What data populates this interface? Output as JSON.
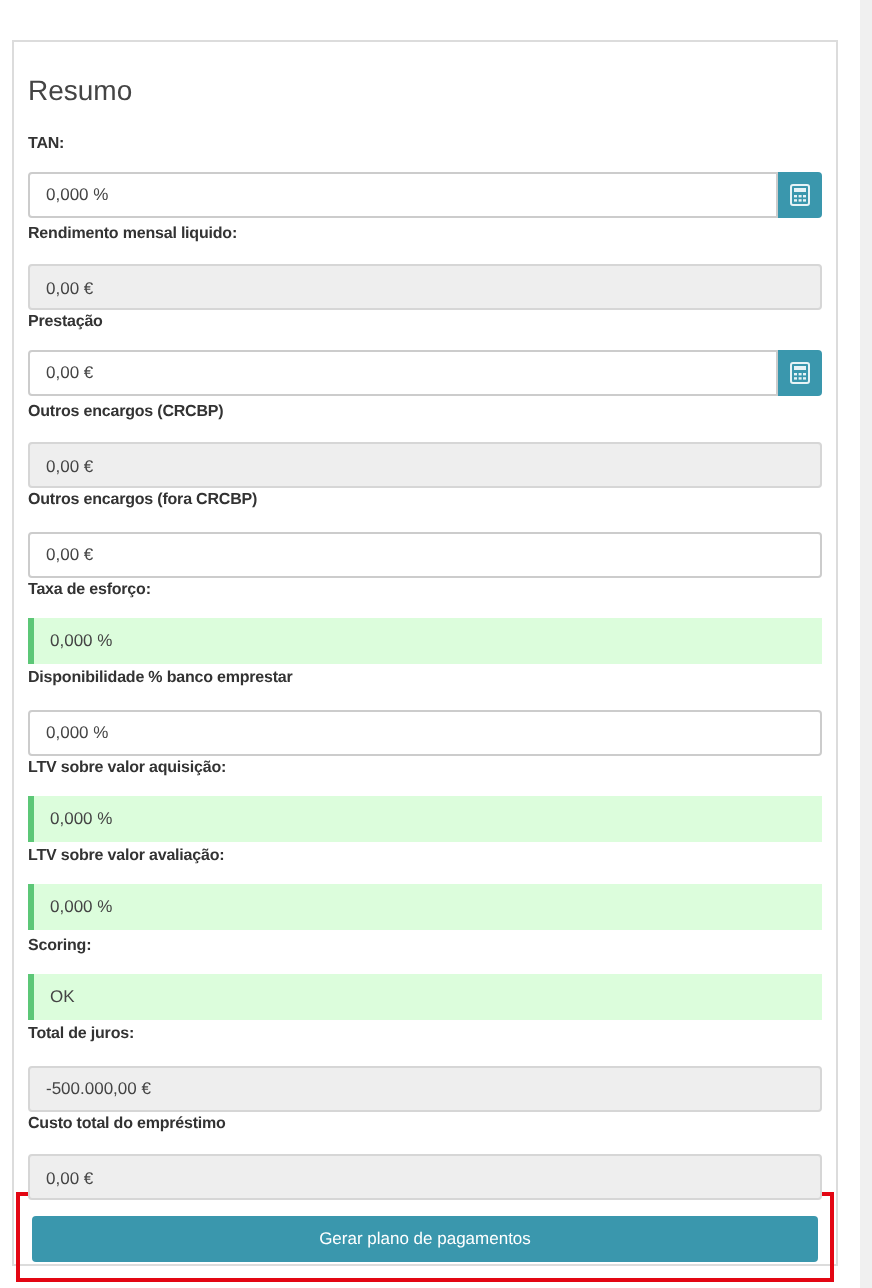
{
  "title": "Resumo",
  "fields": [
    {
      "label": "TAN:",
      "value": "0,000 %",
      "kind": "calc"
    },
    {
      "label": "Rendimento mensal liquido:",
      "value": "0,00 €",
      "kind": "readonly"
    },
    {
      "label": "Prestação",
      "value": "0,00 €",
      "kind": "calc"
    },
    {
      "label": "Outros encargos (CRCBP)",
      "value": "0,00 €",
      "kind": "readonly"
    },
    {
      "label": "Outros encargos (fora CRCBP)",
      "value": "0,00 €",
      "kind": "input"
    },
    {
      "label": "Taxa de esforço:",
      "value": "0,000 %",
      "kind": "status"
    },
    {
      "label": "Disponibilidade % banco emprestar",
      "value": "0,000 %",
      "kind": "input"
    },
    {
      "label": "LTV sobre valor aquisição:",
      "value": "0,000 %",
      "kind": "status"
    },
    {
      "label": "LTV sobre valor avaliação:",
      "value": "0,000 %",
      "kind": "status"
    },
    {
      "label": "Scoring:",
      "value": "OK",
      "kind": "status"
    },
    {
      "label": "Total de juros:",
      "value": "-500.000,00 €",
      "kind": "readonly"
    },
    {
      "label": "Custo total do empréstimo",
      "value": "0,00 €",
      "kind": "readonly"
    }
  ],
  "button": {
    "label": "Gerar plano de pagamentos",
    "highlighted": true
  }
}
